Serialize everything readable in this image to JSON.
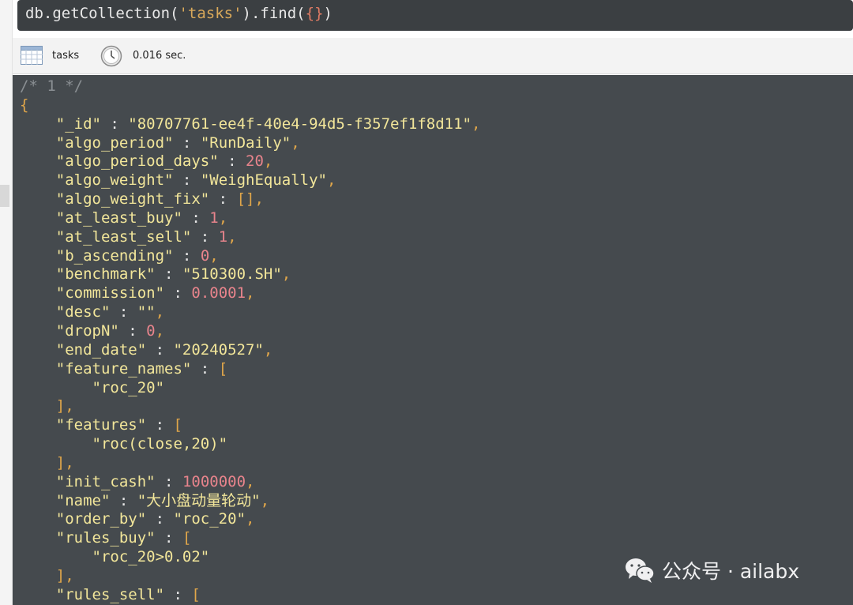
{
  "query": {
    "prefix": "db.getCollection(",
    "collection_literal": "'tasks'",
    "mid": ").find(",
    "args": "{}",
    "suffix": ")"
  },
  "toolbar": {
    "collection_label": "tasks",
    "time_label": "0.016 sec.",
    "icons": [
      "table-icon",
      "clock-icon"
    ]
  },
  "result": {
    "header_comment": "/* 1 */",
    "open_brace": "{",
    "fields": [
      {
        "key": "\"_id\"",
        "value": "\"80707761-ee4f-40e4-94d5-f357ef1f8d11\"",
        "type": "string"
      },
      {
        "key": "\"algo_period\"",
        "value": "\"RunDaily\"",
        "type": "string"
      },
      {
        "key": "\"algo_period_days\"",
        "value": "20",
        "type": "number"
      },
      {
        "key": "\"algo_weight\"",
        "value": "\"WeighEqually\"",
        "type": "string"
      },
      {
        "key": "\"algo_weight_fix\"",
        "value": "[]",
        "type": "punct"
      },
      {
        "key": "\"at_least_buy\"",
        "value": "1",
        "type": "number"
      },
      {
        "key": "\"at_least_sell\"",
        "value": "1",
        "type": "number"
      },
      {
        "key": "\"b_ascending\"",
        "value": "0",
        "type": "number"
      },
      {
        "key": "\"benchmark\"",
        "value": "\"510300.SH\"",
        "type": "string"
      },
      {
        "key": "\"commission\"",
        "value": "0.0001",
        "type": "number"
      },
      {
        "key": "\"desc\"",
        "value": "\"\"",
        "type": "string"
      },
      {
        "key": "\"dropN\"",
        "value": "0",
        "type": "number"
      },
      {
        "key": "\"end_date\"",
        "value": "\"20240527\"",
        "type": "string"
      },
      {
        "key": "\"feature_names\"",
        "array": [
          "\"roc_20\""
        ]
      },
      {
        "key": "\"features\"",
        "array": [
          "\"roc(close,20)\""
        ]
      },
      {
        "key": "\"init_cash\"",
        "value": "1000000",
        "type": "number"
      },
      {
        "key": "\"name\"",
        "value": "\"大小盘动量轮动\"",
        "type": "string"
      },
      {
        "key": "\"order_by\"",
        "value": "\"roc_20\"",
        "type": "string"
      },
      {
        "key": "\"rules_buy\"",
        "array": [
          "\"roc_20>0.02\""
        ]
      },
      {
        "key": "\"rules_sell\"",
        "array_open_only": true
      }
    ]
  },
  "watermark": {
    "text": "公众号 · ailabx",
    "icon": "wechat-icon"
  },
  "colors": {
    "editor_bg": "#454a4e",
    "query_bg": "#3b3f42",
    "key": "#f2e69a",
    "number": "#e8848c",
    "punct": "#e0a64a",
    "comment": "#8a8f93"
  }
}
